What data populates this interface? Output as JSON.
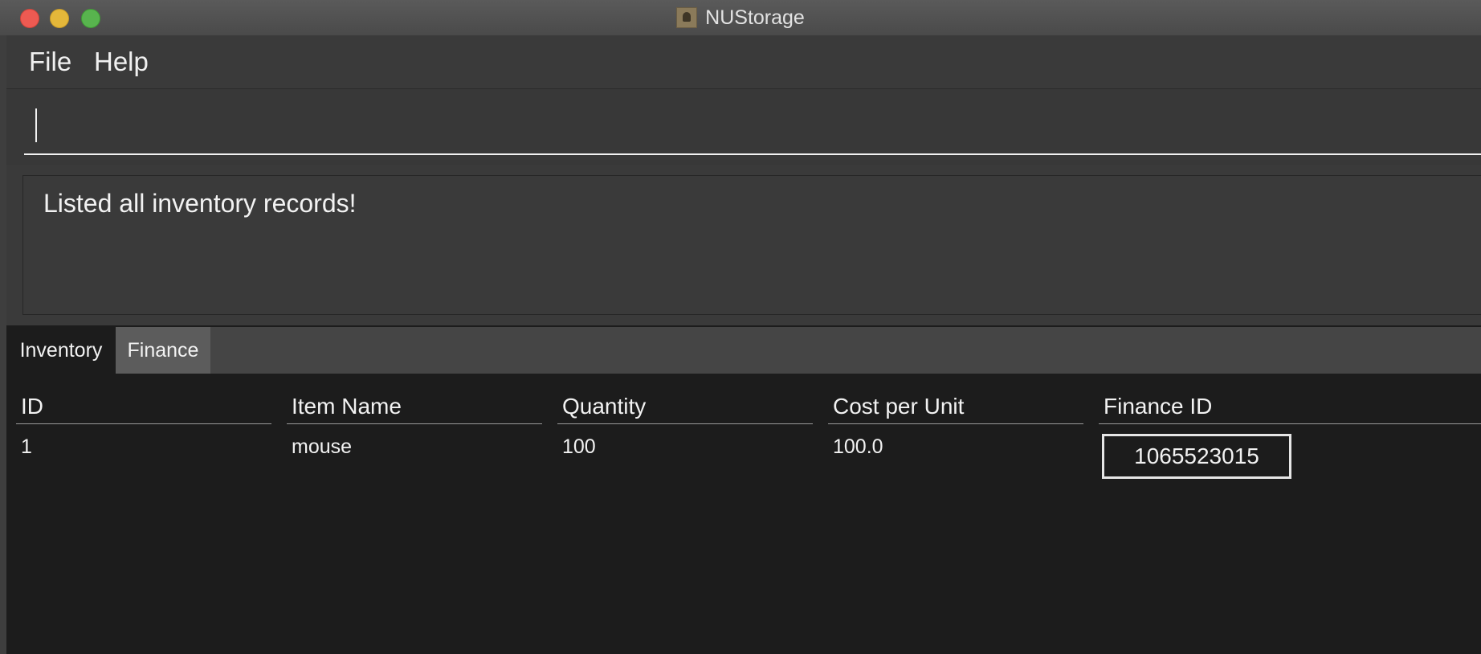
{
  "window": {
    "title": "NUStorage"
  },
  "menu": {
    "file": "File",
    "help": "Help"
  },
  "command": {
    "value": ""
  },
  "result": {
    "message": "Listed all inventory records!"
  },
  "tabs": [
    {
      "label": "Inventory",
      "active": true
    },
    {
      "label": "Finance",
      "active": false
    }
  ],
  "table": {
    "headers": {
      "id": "ID",
      "item_name": "Item Name",
      "quantity": "Quantity",
      "cost_per_unit": "Cost per Unit",
      "finance_id": "Finance ID"
    },
    "rows": [
      {
        "id": "1",
        "item_name": "mouse",
        "quantity": "100",
        "cost_per_unit": "100.0",
        "finance_id": "1065523015"
      }
    ]
  },
  "colors": {
    "background": "#1c1c1c",
    "titlebar": "#4f4f4f",
    "panel": "#3a3a3a",
    "text": "#f2f2f2"
  }
}
